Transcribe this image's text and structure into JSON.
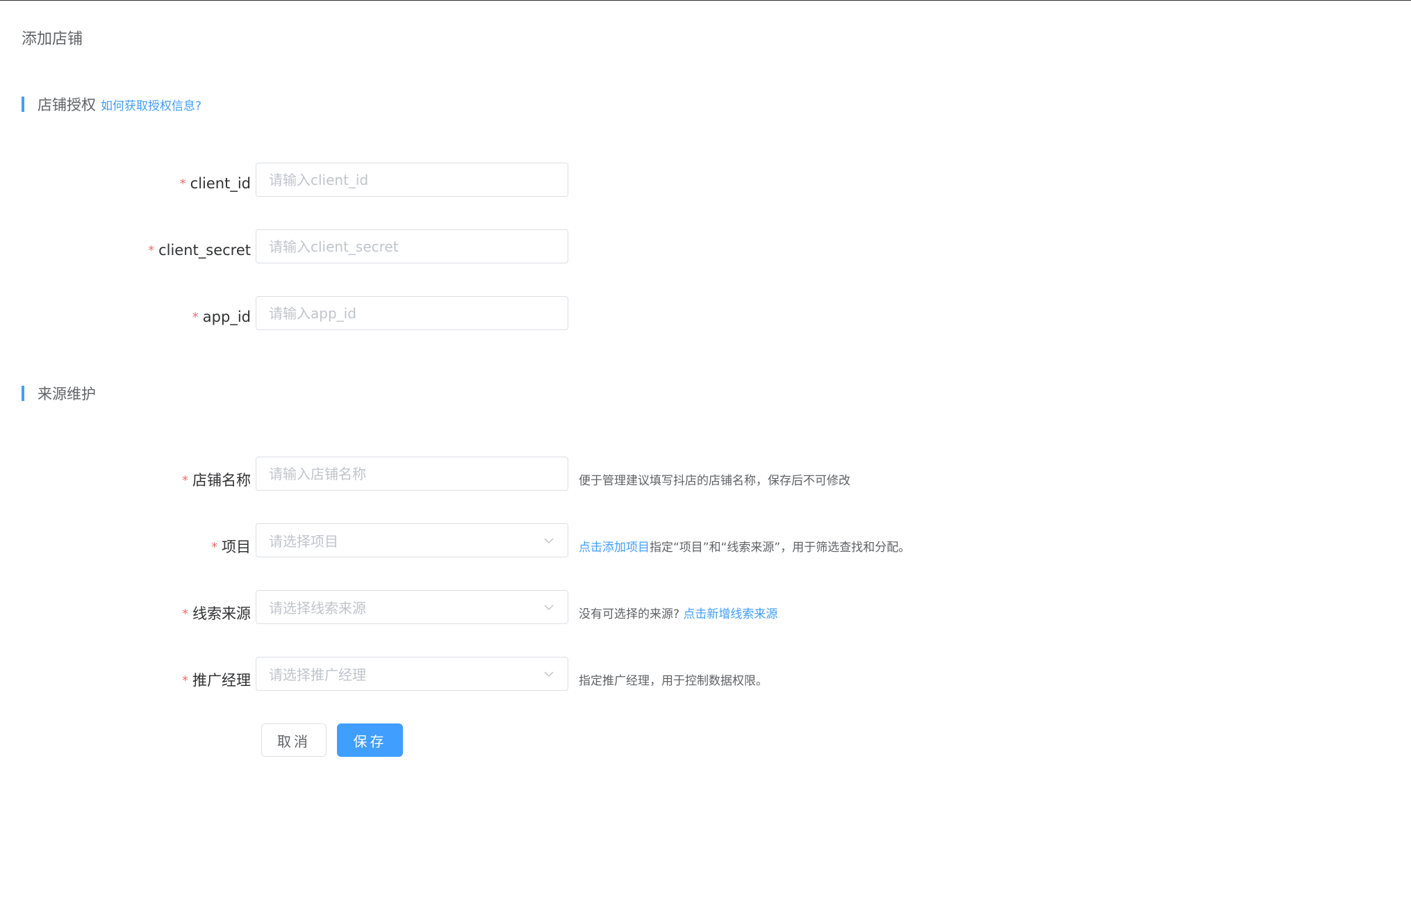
{
  "page": {
    "title": "添加店铺"
  },
  "auth_section": {
    "title": "店铺授权",
    "help_link": "如何获取授权信息?"
  },
  "auth_fields": [
    {
      "label": "client_id",
      "placeholder": "请输入client_id"
    },
    {
      "label": "client_secret",
      "placeholder": "请输入client_secret"
    },
    {
      "label": "app_id",
      "placeholder": "请输入app_id"
    }
  ],
  "source_section": {
    "title": "来源维护"
  },
  "source_fields": {
    "shop_name": {
      "label": "店铺名称",
      "placeholder": "请输入店铺名称",
      "hint": "便于管理建议填写抖店的店铺名称，保存后不可修改"
    },
    "project": {
      "label": "项目",
      "placeholder": "请选择项目",
      "hint_link": "点击添加项目",
      "hint": "指定“项目”和“线索来源”，用于筛选查找和分配。"
    },
    "lead_source": {
      "label": "线索来源",
      "placeholder": "请选择线索来源",
      "hint": "没有可选择的来源? ",
      "hint_link": "点击新增线索来源"
    },
    "promo_manager": {
      "label": "推广经理",
      "placeholder": "请选择推广经理",
      "hint": "指定推广经理，用于控制数据权限。"
    }
  },
  "required_mark": "*",
  "buttons": {
    "cancel": "取消",
    "save": "保存"
  },
  "colors": {
    "primary": "#409eff",
    "required": "#f56c6c",
    "border": "#dcdfe6",
    "placeholder": "#c0c4cc"
  },
  "icons": {
    "select_arrow": "chevron-down-icon"
  }
}
